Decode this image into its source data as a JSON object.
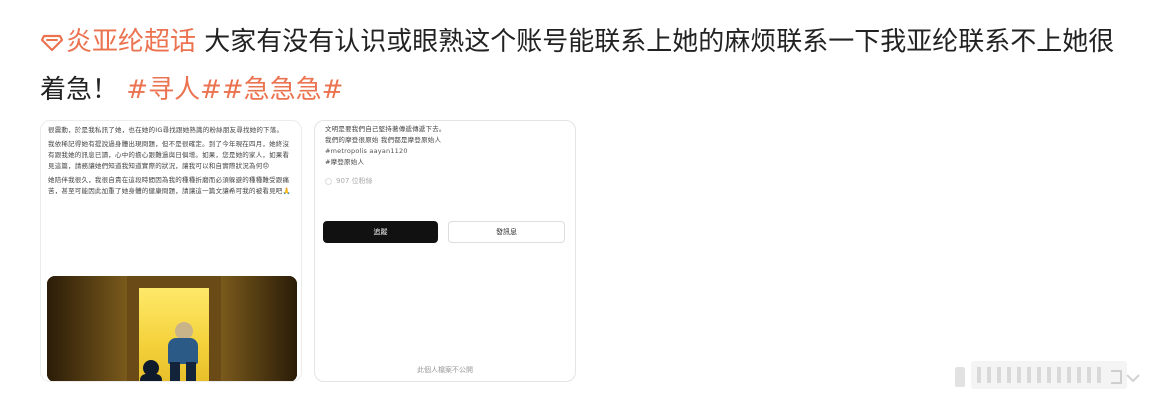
{
  "post": {
    "top_cut_text": "",
    "topic_icon": "supertopic-diamond-icon",
    "topic_name": "炎亚纶超话",
    "body_text": " 大家有没有认识或眼熟这个账号能联系上她的麻烦联系一下我亚纶联系不上她很着急！",
    "hashtags": [
      "#寻人#",
      "#急急急#"
    ]
  },
  "left_card": {
    "paragraphs": [
      "很震動，於是我私訊了她，也在她的IG尋找跟她熟識的粉絲朋友尋找她的下落。",
      "我依稀記得她有提說過身體出現問題，但不是很確定。到了今年現在四月，她終沒有跟我她的訊息已讀，心中的擔心跟難過與日俱增。如果，您是她的家人，如果看見這篇，請務讓她們知道我知道實際的狀況，讓我可以和自實際狀況為何😞",
      "她陪伴我很久，我很自責在這段時間因為我的種種折磨而必須躲避的種種難受跟痛苦，甚至可能因此加重了她身體的健康問題，請讓這一篇文讓希可我的被看見吧🙏"
    ],
    "image_icon": "doorway-illustration-icon"
  },
  "right_card": {
    "lines": [
      "文明是要我們自己堅持著傳遞傳遞下去。",
      "我們的摩登很原始 我們都是摩登原始人",
      "#metropolis aayan1120",
      "#摩登原始人"
    ],
    "followers_text": "907 位粉絲",
    "follow_label": "追蹤",
    "message_label": "發訊息",
    "private_note": "此個人檔案不公開"
  },
  "footer": {
    "collapse_icon": "collapse-toggle-icon"
  },
  "colors": {
    "accent": "#eb7350",
    "text": "#222222",
    "button_dark": "#111111"
  }
}
